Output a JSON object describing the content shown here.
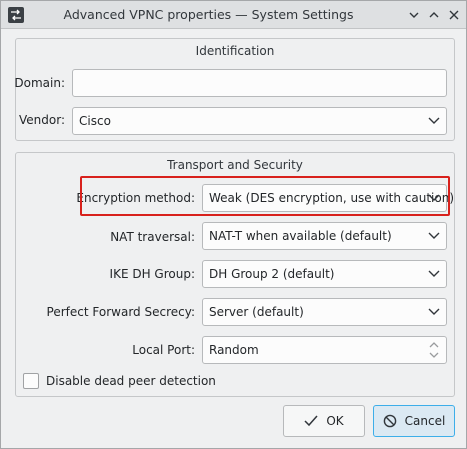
{
  "window": {
    "title": "Advanced VPNC properties — System Settings"
  },
  "identification": {
    "title": "Identification",
    "domain_label": "Domain:",
    "domain_value": "",
    "vendor_label": "Vendor:",
    "vendor_value": "Cisco"
  },
  "transport": {
    "title": "Transport and Security",
    "encryption_label": "Encryption method:",
    "encryption_value": "Weak (DES encryption, use with caution)",
    "nat_label": "NAT traversal:",
    "nat_value": "NAT-T when available (default)",
    "ike_label": "IKE DH Group:",
    "ike_value": "DH Group 2 (default)",
    "pfs_label": "Perfect Forward Secrecy:",
    "pfs_value": "Server (default)",
    "port_label": "Local Port:",
    "port_value": "Random"
  },
  "dead_peer": {
    "label": "Disable dead peer detection",
    "checked": false
  },
  "buttons": {
    "ok": "OK",
    "cancel": "Cancel"
  },
  "colors": {
    "highlight": "#d8211c",
    "accent": "#3daee9"
  }
}
